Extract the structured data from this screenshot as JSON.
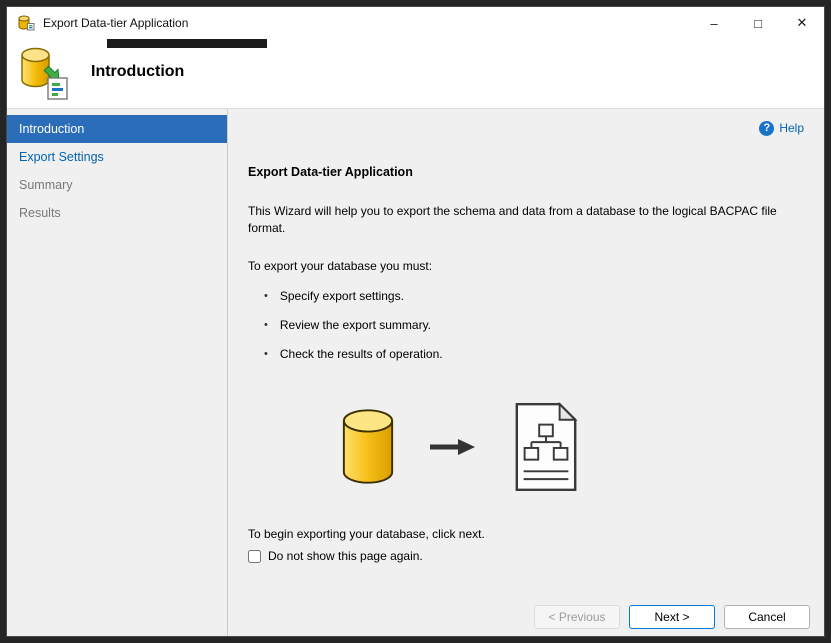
{
  "window": {
    "title": "Export Data-tier Application",
    "controls": {
      "minimize": "–",
      "maximize": "□",
      "close": "✕"
    }
  },
  "header": {
    "title": "Introduction"
  },
  "sidebar": {
    "items": [
      {
        "label": "Introduction",
        "state": "selected"
      },
      {
        "label": "Export Settings",
        "state": "link"
      },
      {
        "label": "Summary",
        "state": "disabled"
      },
      {
        "label": "Results",
        "state": "disabled"
      }
    ]
  },
  "content": {
    "help_glyph": "?",
    "help_label": "Help",
    "heading": "Export Data-tier Application",
    "intro": "This Wizard will help you to export the schema and data from a database to the logical BACPAC file format.",
    "list_intro": "To export your database you must:",
    "bullet_glyph": "•",
    "bullets": [
      "Specify export settings.",
      "Review the export summary.",
      "Check the results of operation."
    ],
    "footer_note": "To begin exporting your database, click next.",
    "checkbox_label": "Do not show this page again.",
    "checkbox_checked": false
  },
  "buttons": {
    "previous": "< Previous",
    "next": "Next >",
    "cancel": "Cancel"
  },
  "colors": {
    "nav_selected": "#2b6db8",
    "link": "#0063b1",
    "next_border": "#0078d4",
    "database_yellow": "#f6bf17"
  }
}
